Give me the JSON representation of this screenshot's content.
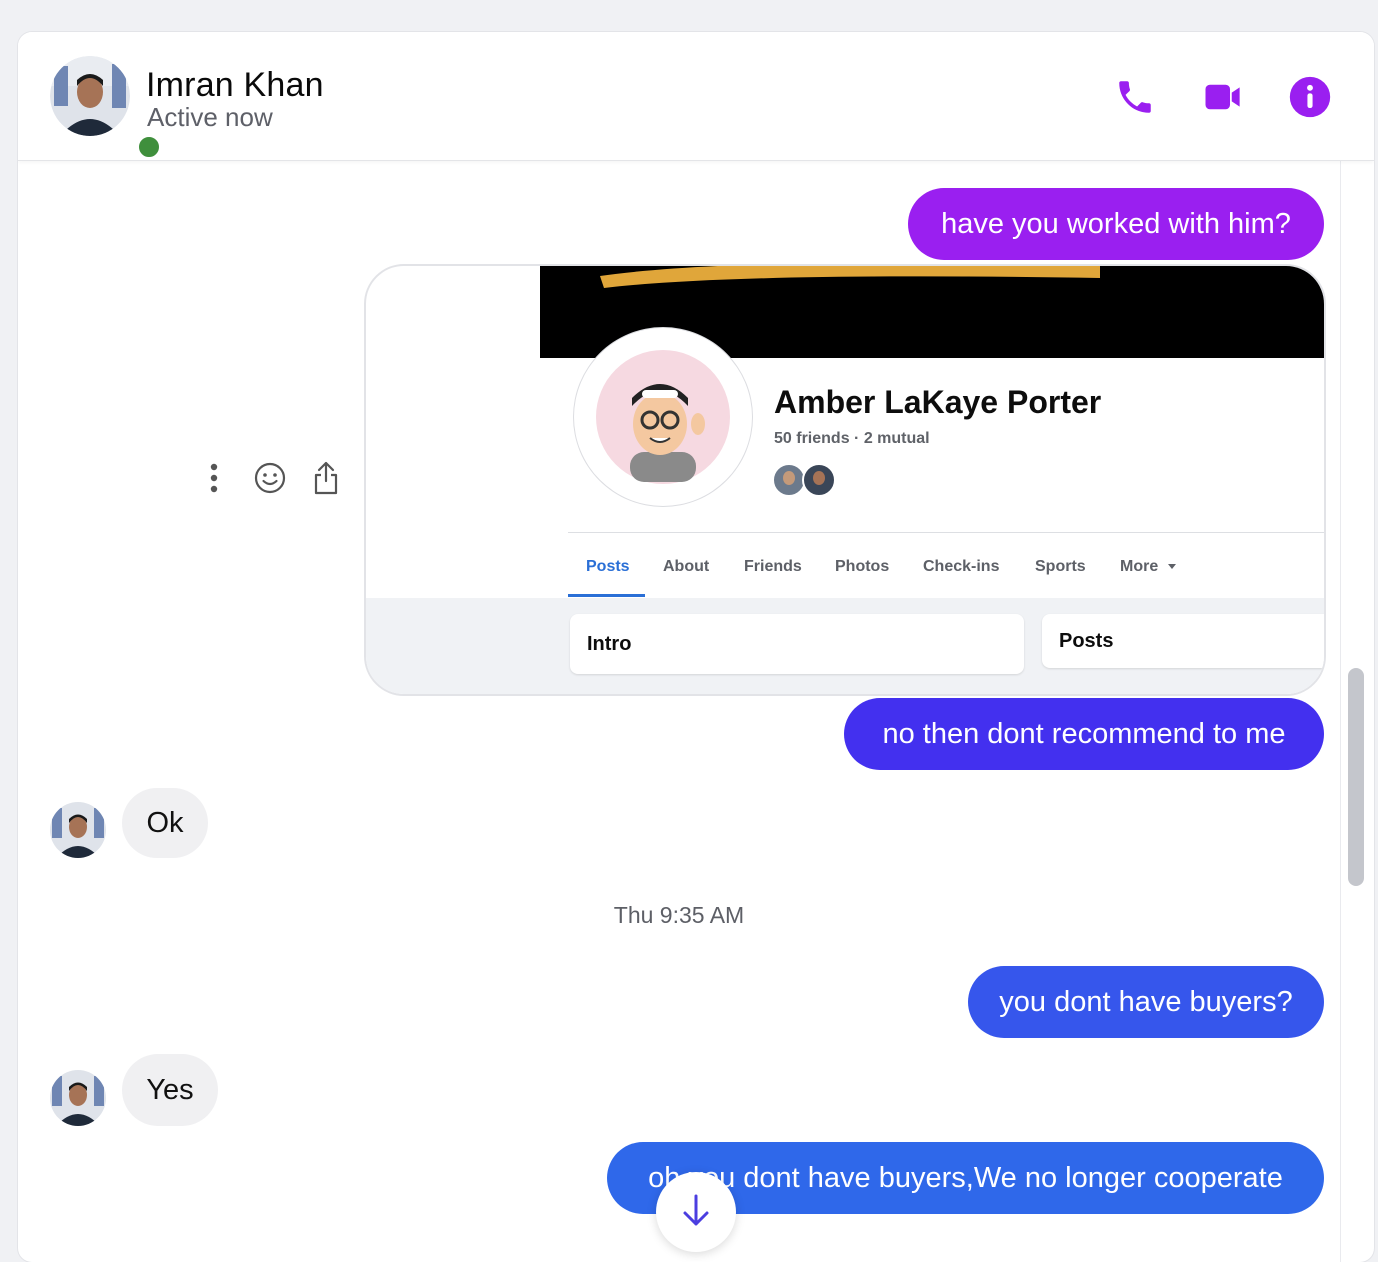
{
  "header": {
    "contact_name": "Imran Khan",
    "status": "Active now",
    "icons": [
      "phone-icon",
      "video-icon",
      "info-icon"
    ],
    "accent_color": "#9a1ff0"
  },
  "messages": [
    {
      "direction": "out",
      "text": "have you worked with him?",
      "color": "#9a1ff0"
    },
    {
      "direction": "out",
      "type": "shared-image",
      "profile": {
        "name": "Amber LaKaye Porter",
        "friends": "50 friends",
        "mutual": "2 mutual",
        "tabs": [
          "Posts",
          "About",
          "Friends",
          "Photos",
          "Check-ins",
          "Sports",
          "More"
        ],
        "active_tab": "Posts",
        "intro_label": "Intro",
        "posts_label": "Posts"
      }
    },
    {
      "direction": "out",
      "text": "no then dont recommend to me",
      "color": "#4330ef"
    },
    {
      "direction": "in",
      "text": "Ok"
    },
    {
      "direction": "out",
      "text": "you dont have buyers?",
      "color": "#3656ec"
    },
    {
      "direction": "in",
      "text": "Yes"
    },
    {
      "direction": "out",
      "text": "oh you dont have buyers,We no longer cooperate",
      "color": "#2f68ea"
    }
  ],
  "timestamp": "Thu 9:35 AM",
  "message_actions": [
    "more-options-icon",
    "react-emoji-icon",
    "share-icon"
  ],
  "scroll_down_icon": "arrow-down-icon"
}
